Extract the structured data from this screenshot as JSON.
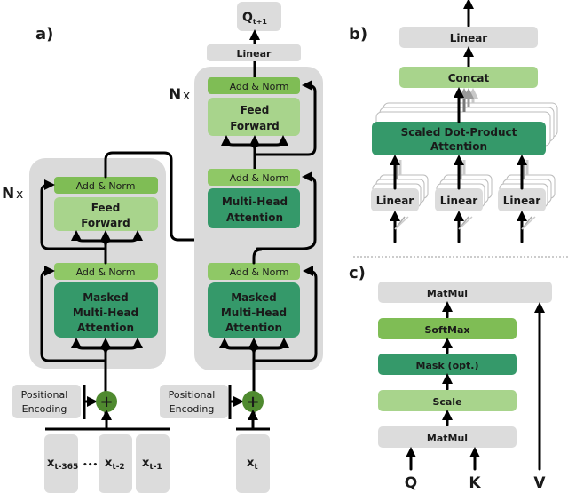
{
  "colors": {
    "gray_box": "#dcdcdc",
    "gray_panel": "#dadada",
    "add_norm": "#7fbd55",
    "add_norm_light": "#8fc866",
    "feed_forward": "#a8d48c",
    "attention": "#35996a",
    "softmax": "#7fbd55",
    "plus_circle": "#4f8a2f"
  },
  "panel_a": {
    "label": "a)",
    "encoder": {
      "repeat_label_bold": "N",
      "repeat_label_x": "x",
      "add_norm_top": "Add & Norm",
      "feed_forward_line1": "Feed",
      "feed_forward_line2": "Forward",
      "add_norm_bottom": "Add & Norm",
      "masked_attention_line1": "Masked",
      "masked_attention_line2": "Multi-Head",
      "masked_attention_line3": "Attention",
      "positional_line1": "Positional",
      "positional_line2": "Encoding",
      "inputs": [
        {
          "base": "x",
          "sub": "t-365"
        },
        {
          "base": "x",
          "sub": "t-2"
        },
        {
          "base": "x",
          "sub": "t-1"
        }
      ],
      "ellipsis": "•••"
    },
    "decoder": {
      "repeat_label_bold": "N",
      "repeat_label_x": "x",
      "output_base": "Q",
      "output_sub": "t+1",
      "linear": "Linear",
      "add_norm_1": "Add & Norm",
      "feed_forward_line1": "Feed",
      "feed_forward_line2": "Forward",
      "add_norm_2": "Add & Norm",
      "attention_line1": "Multi-Head",
      "attention_line2": "Attention",
      "add_norm_3": "Add & Norm",
      "masked_attention_line1": "Masked",
      "masked_attention_line2": "Multi-Head",
      "masked_attention_line3": "Attention",
      "positional_line1": "Positional",
      "positional_line2": "Encoding",
      "input_base": "x",
      "input_sub": "t"
    }
  },
  "panel_b": {
    "label": "b)",
    "linear_top": "Linear",
    "concat": "Concat",
    "attention_line1": "Scaled Dot-Product",
    "attention_line2": "Attention",
    "linear_inputs": [
      "Linear",
      "Linear",
      "Linear"
    ]
  },
  "panel_c": {
    "label": "c)",
    "matmul_top": "MatMul",
    "softmax": "SoftMax",
    "mask": "Mask (opt.)",
    "scale": "Scale",
    "matmul_bottom": "MatMul",
    "inputs": [
      "Q",
      "K",
      "V"
    ]
  }
}
